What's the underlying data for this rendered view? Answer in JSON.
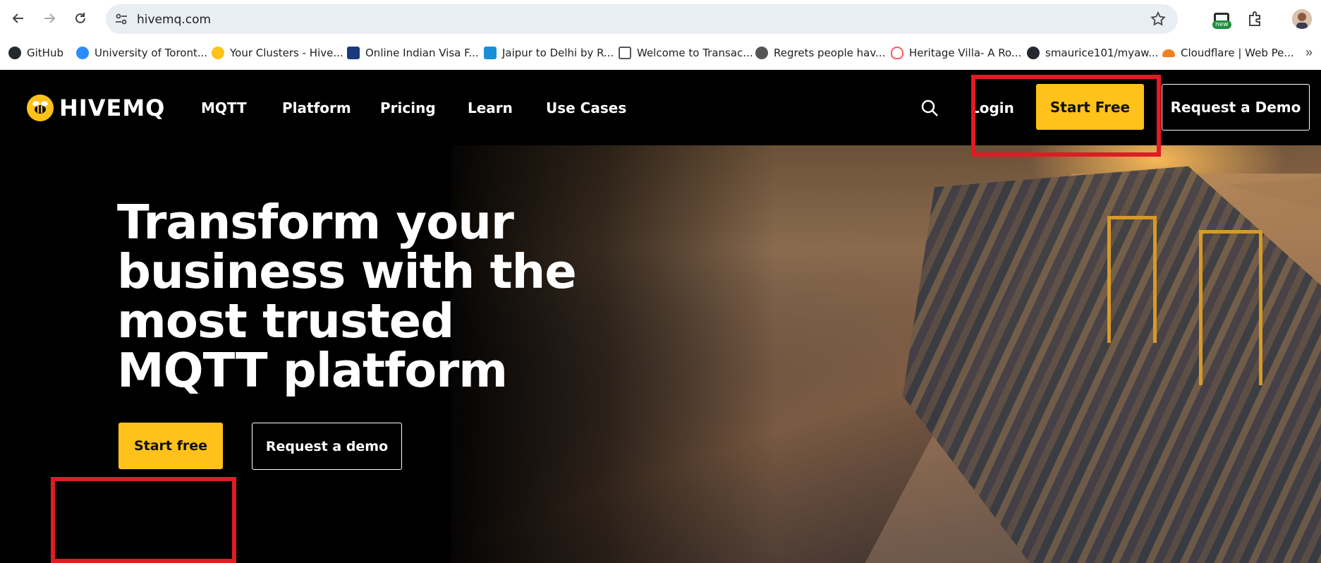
{
  "browser": {
    "url": "hivemq.com",
    "new_badge": "new",
    "bookmarks": [
      {
        "label": "GitHub",
        "icon": "github-icon",
        "color": "#24292f"
      },
      {
        "label": "University of Toront...",
        "icon": "zoom-icon",
        "color": "#2d8cff"
      },
      {
        "label": "Your Clusters - Hive...",
        "icon": "hivemq-icon",
        "color": "#ffc21a"
      },
      {
        "label": "Online Indian Visa F...",
        "icon": "nic-icon",
        "color": "#1a3a7a"
      },
      {
        "label": "Jaipur to Delhi by R...",
        "icon": "s-icon",
        "color": "#1a8fd8"
      },
      {
        "label": "Welcome to Transac...",
        "icon": "building-icon",
        "color": "#555555"
      },
      {
        "label": "Regrets people hav...",
        "icon": "globe-icon",
        "color": "#555555"
      },
      {
        "label": "Heritage Villa- A Ro...",
        "icon": "airbnb-icon",
        "color": "#ff5a5f"
      },
      {
        "label": "smaurice101/myaw...",
        "icon": "github-icon",
        "color": "#24292f"
      },
      {
        "label": "Cloudflare | Web Pe...",
        "icon": "cloudflare-icon",
        "color": "#f38020"
      }
    ]
  },
  "site": {
    "logo": "HIVEMQ",
    "menu": [
      "MQTT",
      "Platform",
      "Pricing",
      "Learn",
      "Use Cases"
    ],
    "login": "Login",
    "start_free_top": "Start Free",
    "request_demo_top": "Request a Demo",
    "hero": {
      "headline": "Transform your business with the most trusted MQTT platform",
      "start_free": "Start free",
      "request_demo": "Request a demo"
    }
  },
  "colors": {
    "accent": "#ffc21a",
    "highlight": "#e01b24"
  }
}
